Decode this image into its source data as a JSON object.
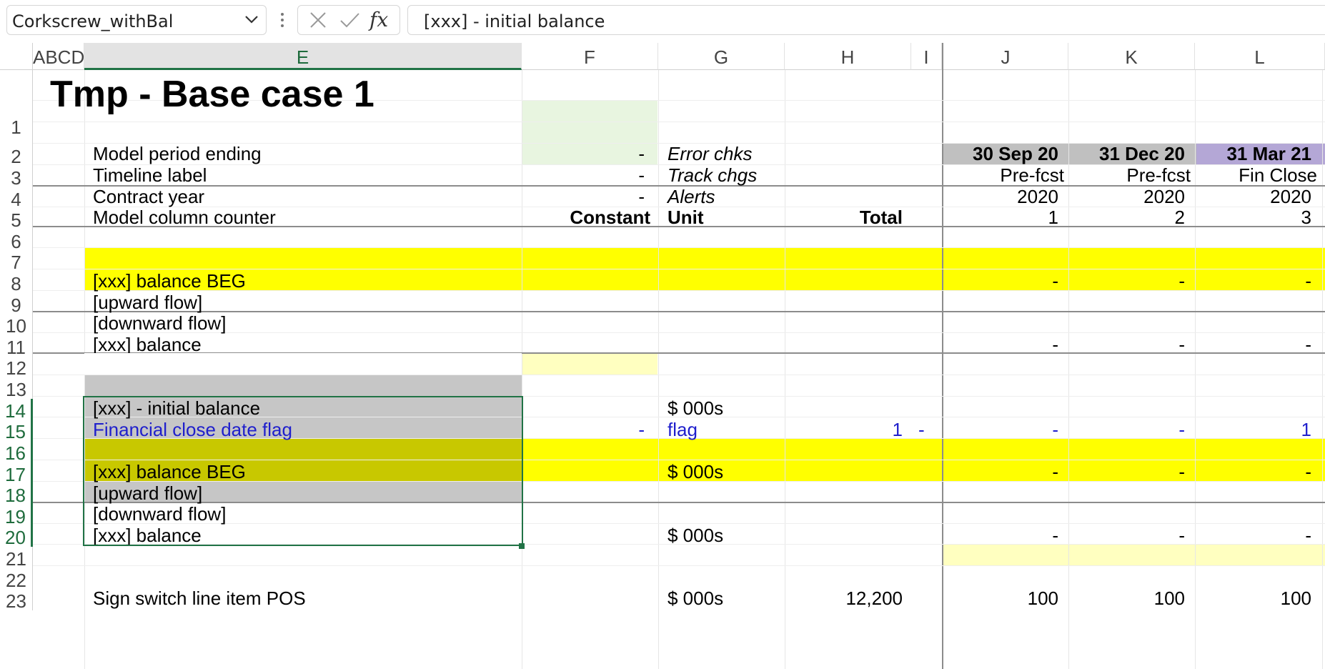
{
  "formula_bar": {
    "name_box": "Corkscrew_withBal",
    "formula": "[xxx] - initial balance",
    "fx_label": "fx"
  },
  "columns": {
    "abcd": "ABCD",
    "e": "E",
    "f": "F",
    "g": "G",
    "h": "H",
    "i": "I",
    "j": "J",
    "k": "K",
    "l": "L"
  },
  "rows": [
    "1",
    "2",
    "3",
    "4",
    "5",
    "6",
    "7",
    "8",
    "9",
    "10",
    "11",
    "12",
    "13",
    "14",
    "15",
    "16",
    "17",
    "18",
    "19",
    "20",
    "21",
    "22",
    "23"
  ],
  "sheet": {
    "title": "Tmp - Base case 1",
    "r2": {
      "label": "Model period ending",
      "f": "-",
      "g": "Error chks",
      "j": "30 Sep 20",
      "k": "31 Dec 20",
      "l": "31 Mar 21"
    },
    "r3": {
      "label": "Timeline label",
      "f": "-",
      "g": "Track chgs",
      "j": "Pre-fcst",
      "k": "Pre-fcst",
      "l": "Fin Close"
    },
    "r4": {
      "label": "Contract year",
      "f": "-",
      "g": "Alerts",
      "j": "2020",
      "k": "2020",
      "l": "2020"
    },
    "r5": {
      "label": "Model column counter",
      "f": "Constant",
      "g": "Unit",
      "h": "Total",
      "j": "1",
      "k": "2",
      "l": "3"
    },
    "r8": {
      "label": "[xxx] balance BEG",
      "j": "-",
      "k": "-",
      "l": "-"
    },
    "r9": {
      "label": "[upward flow]"
    },
    "r10": {
      "label": "[downward flow]"
    },
    "r11": {
      "label": "[xxx] balance",
      "j": "-",
      "k": "-",
      "l": "-"
    },
    "r14": {
      "label": "[xxx] - initial balance",
      "g": "$ 000s"
    },
    "r15": {
      "label": "Financial close date flag",
      "f": "-",
      "g": "flag",
      "h": "1",
      "i": "-",
      "j": "-",
      "k": "-",
      "l": "1"
    },
    "r17": {
      "label": "[xxx] balance BEG",
      "g": "$ 000s",
      "j": "-",
      "k": "-",
      "l": "-"
    },
    "r18": {
      "label": "[upward flow]"
    },
    "r19": {
      "label": "[downward flow]"
    },
    "r20": {
      "label": "[xxx] balance",
      "g": "$ 000s",
      "j": "-",
      "k": "-",
      "l": "-"
    },
    "r23": {
      "label": "Sign switch line item POS",
      "g": "$ 000s",
      "h": "12,200",
      "j": "100",
      "k": "100",
      "l": "100"
    }
  },
  "colors": {
    "selection_green": "#217346",
    "input_light_green": "#e8f5e0",
    "yellow_band": "#ffff00",
    "input_yellow": "#ffffc0",
    "grey_timeline": "#c0c0c0",
    "purple_finclose": "#b4a7d6",
    "selection_grey": "#c6c6c6",
    "selection_yellow": "#c8c800"
  }
}
